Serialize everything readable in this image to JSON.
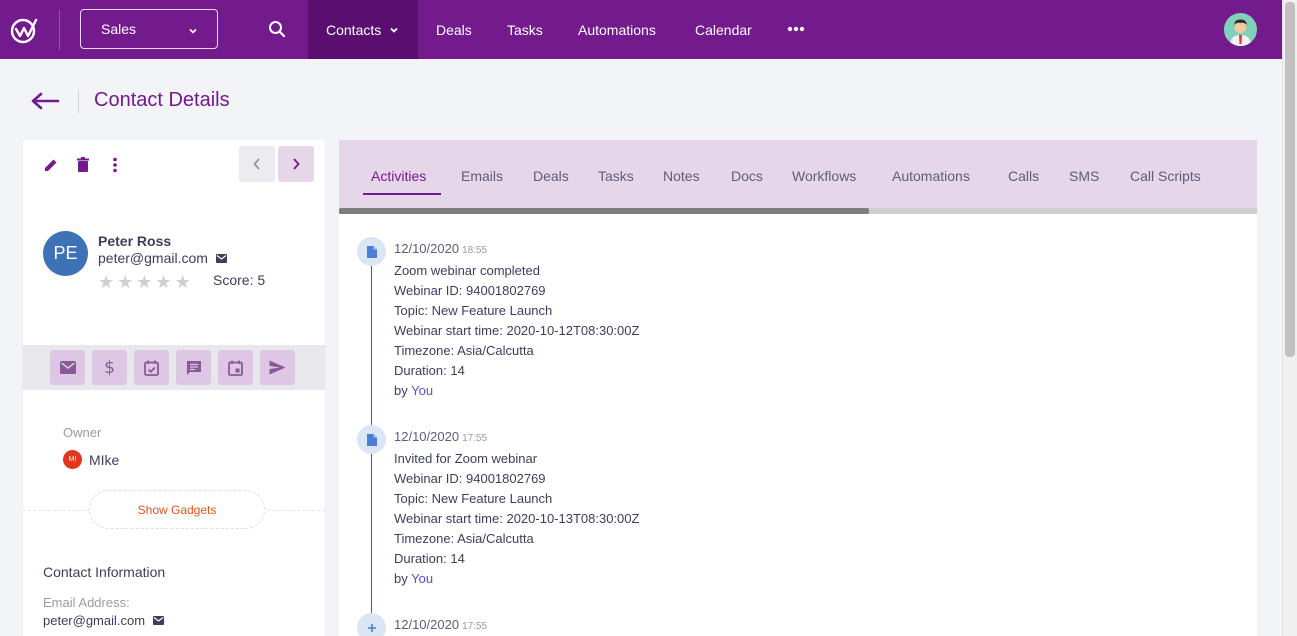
{
  "topbar": {
    "pipeline_select": "Sales",
    "nav": [
      "Contacts",
      "Deals",
      "Tasks",
      "Automations",
      "Calendar"
    ]
  },
  "page": {
    "title": "Contact Details"
  },
  "contact": {
    "initials": "PE",
    "name": "Peter Ross",
    "email": "peter@gmail.com",
    "rating": 0,
    "score_text": "Score: 5",
    "owner_label": "Owner",
    "owner_initials": "MI",
    "owner_name": "MIke",
    "show_gadgets": "Show Gadgets",
    "info_title": "Contact Information",
    "email_label": "Email Address:",
    "email_value": "peter@gmail.com"
  },
  "tabs": [
    "Activities",
    "Emails",
    "Deals",
    "Tasks",
    "Notes",
    "Docs",
    "Workflows",
    "Automations",
    "Calls",
    "SMS",
    "Call Scripts"
  ],
  "activities": [
    {
      "date": "12/10/2020",
      "time": "18:55",
      "lines": [
        "Zoom webinar completed",
        "Webinar ID: 94001802769",
        "Topic: New Feature Launch",
        "Webinar start time: 2020-10-12T08:30:00Z",
        "Timezone: Asia/Calcutta",
        "Duration: 14"
      ],
      "by_prefix": "by",
      "by": "You",
      "icon": "document-icon"
    },
    {
      "date": "12/10/2020",
      "time": "17:55",
      "lines": [
        "Invited for Zoom webinar",
        "Webinar ID: 94001802769",
        "Topic: New Feature Launch",
        "Webinar start time: 2020-10-13T08:30:00Z",
        "Timezone: Asia/Calcutta",
        "Duration: 14"
      ],
      "by_prefix": "by",
      "by": "You",
      "icon": "document-icon"
    },
    {
      "date": "12/10/2020",
      "time": "17:55",
      "icon": "plus-icon"
    }
  ],
  "colors": {
    "brand": "#731a8c",
    "brand_dark": "#5a0f70",
    "tab_bg": "#e6d6ea",
    "link": "#5b4dd6",
    "owner_badge": "#e0371d"
  }
}
